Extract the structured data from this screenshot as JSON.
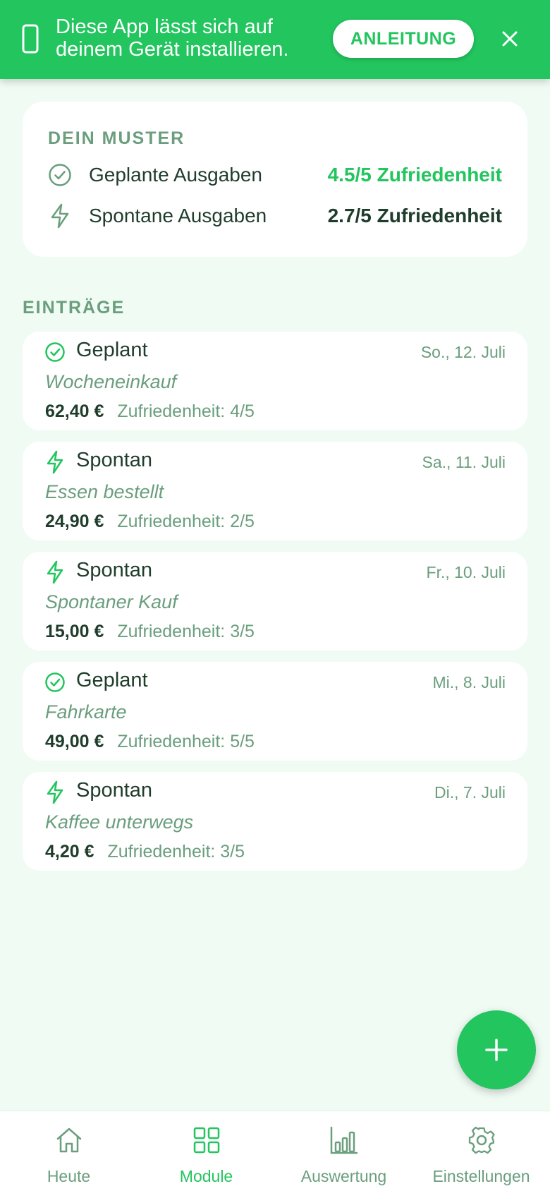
{
  "banner": {
    "message": "Diese App lässt sich auf deinem Gerät installieren.",
    "button_label": "ANLEITUNG",
    "icons": [
      "phone-icon",
      "close-icon"
    ]
  },
  "colors": {
    "accent": "#22c55e",
    "background": "#f0fbf4",
    "text_dark": "#1f3d2b",
    "text_muted": "#6a9e7d"
  },
  "pattern": {
    "title": "DEIN MUSTER",
    "rows": [
      {
        "icon": "check-circle-icon",
        "label": "Geplante Ausgaben",
        "value": "4.5/5 Zufriedenheit",
        "value_color": "#22c55e"
      },
      {
        "icon": "lightning-icon",
        "label": "Spontane Ausgaben",
        "value": "2.7/5 Zufriedenheit",
        "value_color": "#1f3d2b"
      }
    ]
  },
  "entries": {
    "title": "EINTRÄGE",
    "items": [
      {
        "type": "Geplant",
        "icon": "check-circle-icon",
        "date": "So., 12. Juli",
        "description": "Wocheneinkauf",
        "amount": "62,40 €",
        "satisfaction": "Zufriedenheit: 4/5"
      },
      {
        "type": "Spontan",
        "icon": "lightning-icon",
        "date": "Sa., 11. Juli",
        "description": "Essen bestellt",
        "amount": "24,90 €",
        "satisfaction": "Zufriedenheit: 2/5"
      },
      {
        "type": "Spontan",
        "icon": "lightning-icon",
        "date": "Fr., 10. Juli",
        "description": "Spontaner Kauf",
        "amount": "15,00 €",
        "satisfaction": "Zufriedenheit: 3/5"
      },
      {
        "type": "Geplant",
        "icon": "check-circle-icon",
        "date": "Mi., 8. Juli",
        "description": "Fahrkarte",
        "amount": "49,00 €",
        "satisfaction": "Zufriedenheit: 5/5"
      },
      {
        "type": "Spontan",
        "icon": "lightning-icon",
        "date": "Di., 7. Juli",
        "description": "Kaffee unterwegs",
        "amount": "4,20 €",
        "satisfaction": "Zufriedenheit: 3/5"
      }
    ]
  },
  "fab": {
    "icon": "plus-icon"
  },
  "nav": {
    "active": "Module",
    "items": [
      {
        "label": "Heute",
        "icon": "home-icon"
      },
      {
        "label": "Module",
        "icon": "grid-icon"
      },
      {
        "label": "Auswertung",
        "icon": "bar-chart-icon"
      },
      {
        "label": "Einstellungen",
        "icon": "gear-icon"
      }
    ]
  }
}
